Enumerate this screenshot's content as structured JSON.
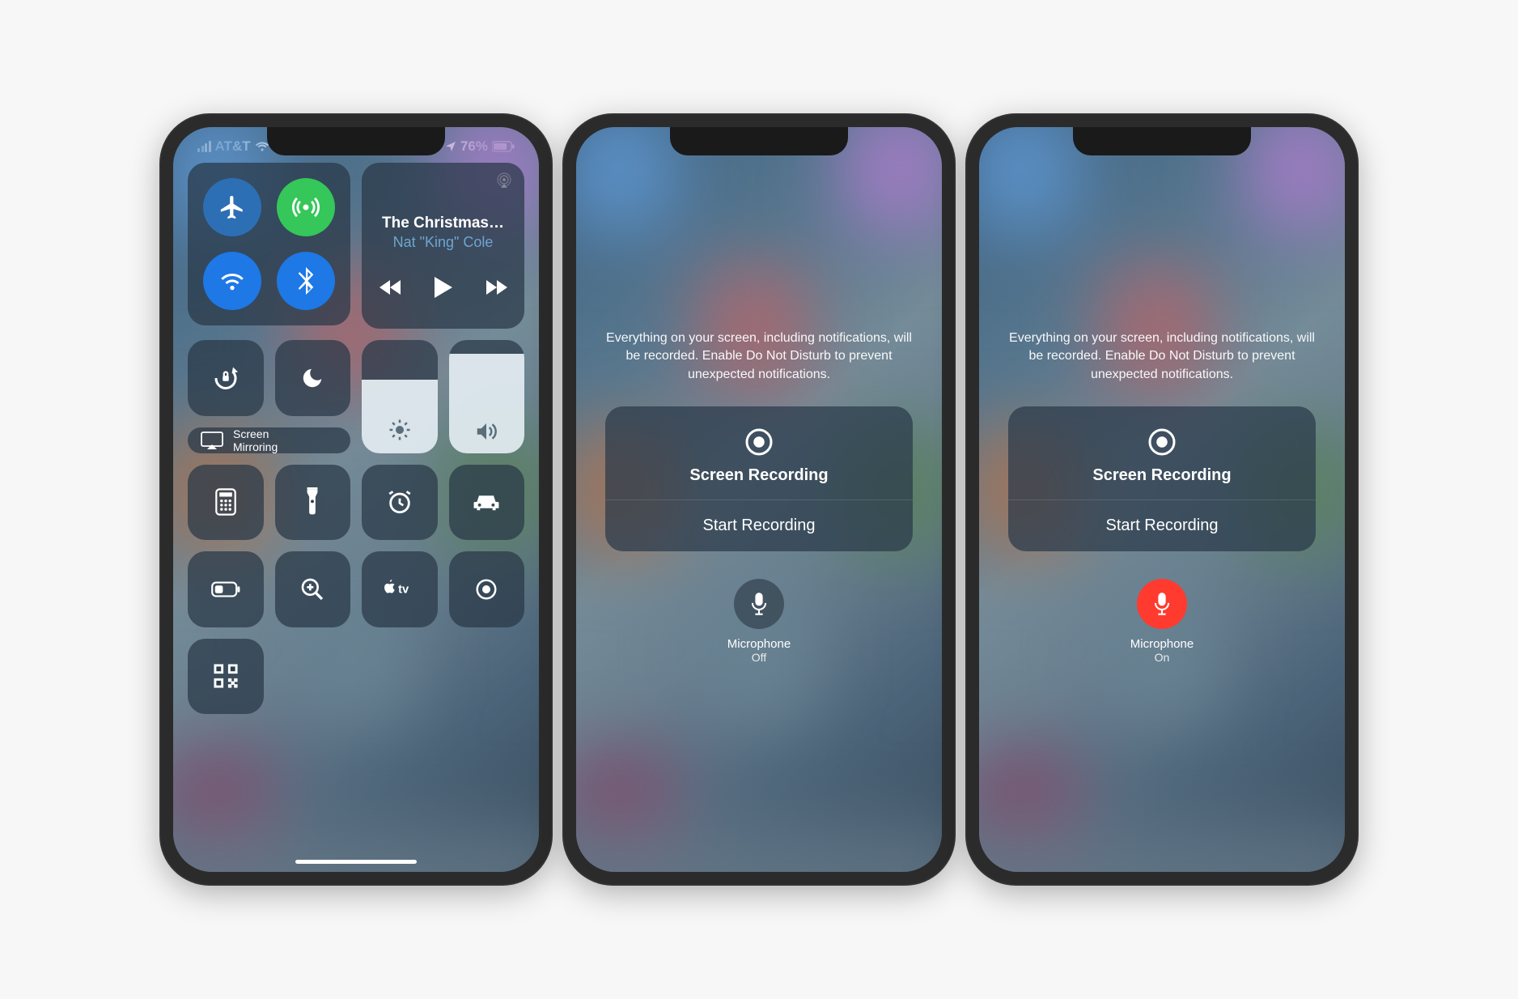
{
  "status": {
    "carrier": "AT&T",
    "battery": "76%"
  },
  "music": {
    "title": "The Christmas…",
    "artist": "Nat \"King\" Cole"
  },
  "mirror_label": "Screen Mirroring",
  "brightness_pct": 55,
  "volume_pct": 78,
  "recording": {
    "info": "Everything on your screen, including notifications, will be recorded. Enable Do Not Disturb to prevent unexpected notifications.",
    "title": "Screen Recording",
    "start": "Start Recording",
    "mic_label": "Microphone",
    "mic_off": "Off",
    "mic_on": "On"
  }
}
